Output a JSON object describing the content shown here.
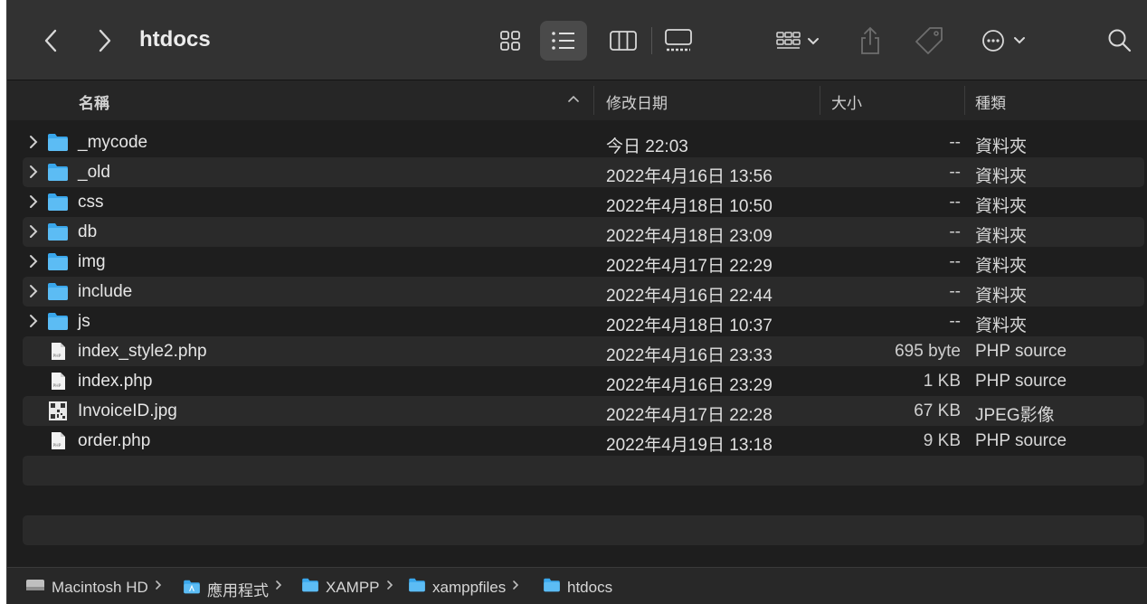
{
  "window": {
    "title": "htdocs"
  },
  "toolbar": {
    "back": "back-icon",
    "forward": "forward-icon",
    "views": [
      "icon-view-icon",
      "list-view-icon",
      "column-view-icon",
      "gallery-view-icon"
    ],
    "active_view": "list-view-icon",
    "group": "group-icon",
    "share": "share-icon",
    "tag": "tag-icon",
    "more": "more-icon",
    "search": "search-icon"
  },
  "columns": {
    "name": "名稱",
    "date": "修改日期",
    "size": "大小",
    "kind": "種類"
  },
  "rows": [
    {
      "name": "_mycode",
      "date": "今日 22:03",
      "size": "--",
      "kind": "資料夾",
      "type": "folder"
    },
    {
      "name": "_old",
      "date": "2022年4月16日 13:56",
      "size": "--",
      "kind": "資料夾",
      "type": "folder"
    },
    {
      "name": "css",
      "date": "2022年4月18日 10:50",
      "size": "--",
      "kind": "資料夾",
      "type": "folder"
    },
    {
      "name": "db",
      "date": "2022年4月18日 23:09",
      "size": "--",
      "kind": "資料夾",
      "type": "folder"
    },
    {
      "name": "img",
      "date": "2022年4月17日 22:29",
      "size": "--",
      "kind": "資料夾",
      "type": "folder"
    },
    {
      "name": "include",
      "date": "2022年4月16日 22:44",
      "size": "--",
      "kind": "資料夾",
      "type": "folder"
    },
    {
      "name": "js",
      "date": "2022年4月18日 10:37",
      "size": "--",
      "kind": "資料夾",
      "type": "folder"
    },
    {
      "name": "index_style2.php",
      "date": "2022年4月16日 23:33",
      "size": "695 byte",
      "kind": "PHP source",
      "type": "php"
    },
    {
      "name": "index.php",
      "date": "2022年4月16日 23:29",
      "size": "1 KB",
      "kind": "PHP source",
      "type": "php"
    },
    {
      "name": "InvoiceID.jpg",
      "date": "2022年4月17日 22:28",
      "size": "67 KB",
      "kind": "JPEG影像",
      "type": "jpg"
    },
    {
      "name": "order.php",
      "date": "2022年4月19日 13:18",
      "size": "9 KB",
      "kind": "PHP source",
      "type": "php"
    }
  ],
  "path": [
    "Macintosh HD",
    "應用程式",
    "XAMPP",
    "xamppfiles",
    "htdocs"
  ],
  "colors": {
    "folder": "#39a7ec",
    "toolbar": "#323232",
    "row_alt": "#2a2a2a"
  }
}
